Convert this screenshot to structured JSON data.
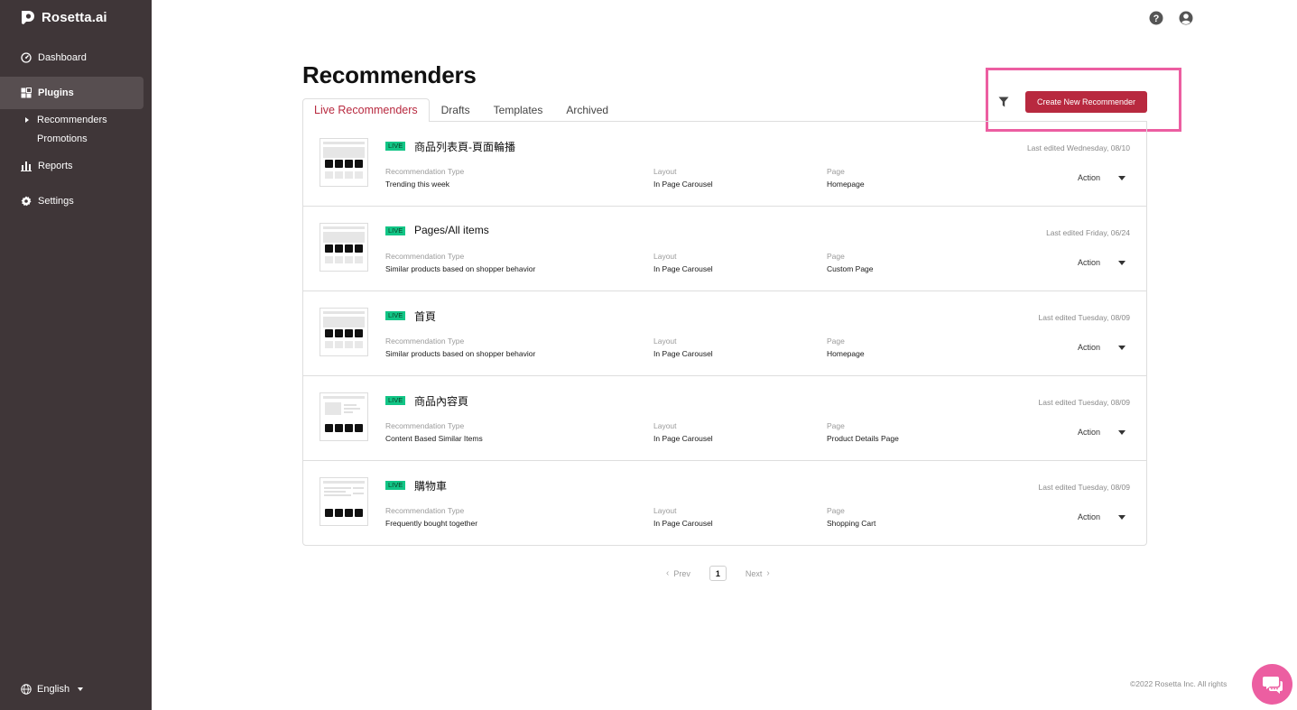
{
  "app": {
    "brand": "Rosetta.ai"
  },
  "sidebar": {
    "items": [
      {
        "label": "Dashboard",
        "icon": "dashboard-icon"
      },
      {
        "label": "Plugins",
        "icon": "plugins-icon"
      },
      {
        "label": "Reports",
        "icon": "reports-icon"
      },
      {
        "label": "Settings",
        "icon": "gear-icon"
      }
    ],
    "sub_items": [
      {
        "label": "Recommenders"
      },
      {
        "label": "Promotions"
      }
    ],
    "language": "English"
  },
  "header": {
    "title": "Recommenders"
  },
  "tabs": [
    {
      "label": "Live Recommenders",
      "active": true
    },
    {
      "label": "Drafts",
      "active": false
    },
    {
      "label": "Templates",
      "active": false
    },
    {
      "label": "Archived",
      "active": false
    }
  ],
  "toolbar": {
    "create_label": "Create New Recommender"
  },
  "columns": {
    "type": "Recommendation Type",
    "layout": "Layout",
    "page": "Page",
    "action": "Action"
  },
  "status_badge": "LIVE",
  "recommenders": [
    {
      "title": "商品列表頁-頁面輪播",
      "edited": "Last edited Wednesday, 08/10",
      "type": "Trending this week",
      "layout": "In Page Carousel",
      "page": "Homepage"
    },
    {
      "title": "Pages/All items",
      "edited": "Last edited Friday, 06/24",
      "type": "Similar products based on shopper behavior",
      "layout": "In Page Carousel",
      "page": "Custom Page"
    },
    {
      "title": "首頁",
      "edited": "Last edited Tuesday, 08/09",
      "type": "Similar products based on shopper behavior",
      "layout": "In Page Carousel",
      "page": "Homepage"
    },
    {
      "title": "商品內容頁",
      "edited": "Last edited Tuesday, 08/09",
      "type": "Content Based Similar Items",
      "layout": "In Page Carousel",
      "page": "Product Details Page"
    },
    {
      "title": "購物車",
      "edited": "Last edited Tuesday, 08/09",
      "type": "Frequently bought together",
      "layout": "In Page Carousel",
      "page": "Shopping Cart"
    }
  ],
  "pagination": {
    "prev": "Prev",
    "current": "1",
    "next": "Next"
  },
  "footer": "©2022 Rosetta Inc. All rights",
  "colors": {
    "sidebar": "#3f3638",
    "accent": "#b8293f",
    "live": "#12c586",
    "highlight": "#ec5ea1"
  }
}
